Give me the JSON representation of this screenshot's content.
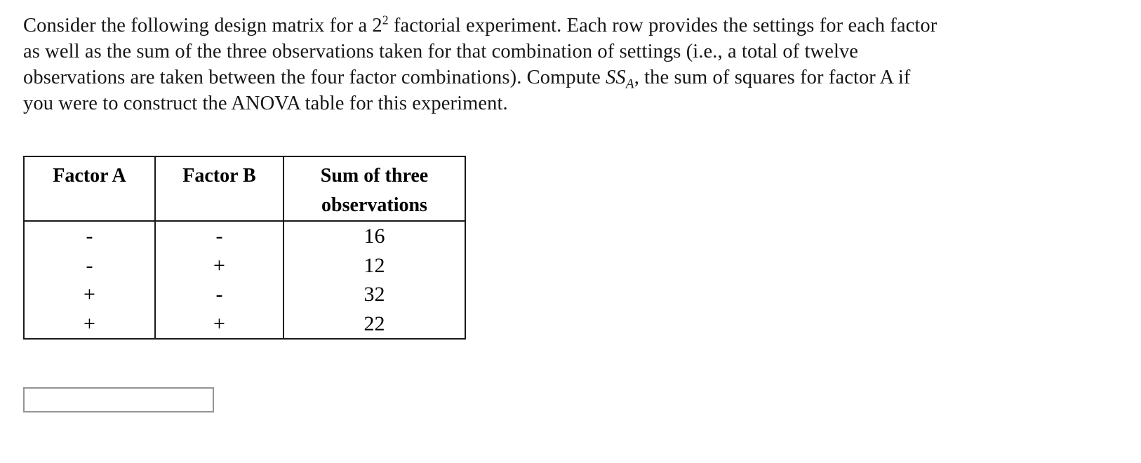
{
  "page": {
    "background_color": "#ffffff",
    "text_color": "#161616"
  },
  "prompt": {
    "line1_a": "Consider the following design matrix for a 2",
    "line1_exponent": "2",
    "line1_b": " factorial experiment. Each row provides the settings for each factor",
    "line2": "as well as the sum of the three observations taken for that combination of settings (i.e., a total of twelve",
    "line3_a": "observations are taken between the four factor combinations). Compute ",
    "line3_sym": "SS",
    "line3_sub": "A",
    "line3_b": ", the sum of squares for factor A if",
    "line4": "you were to construct the ANOVA table for this experiment."
  },
  "matrix_table": {
    "headers": [
      "Factor A",
      "Factor B",
      "Sum of three observations"
    ],
    "header_col3_line1": "Sum of three",
    "header_col3_line2": "observations",
    "rows": [
      {
        "factor_a": "-",
        "factor_b": "-",
        "sum": "16"
      },
      {
        "factor_a": "-",
        "factor_b": "+",
        "sum": "12"
      },
      {
        "factor_a": "+",
        "factor_b": "-",
        "sum": "32"
      },
      {
        "factor_a": "+",
        "factor_b": "+",
        "sum": "22"
      }
    ],
    "border_color": "#1a1a1a"
  },
  "answer": {
    "value": "",
    "placeholder": "",
    "border_color": "#949494"
  }
}
